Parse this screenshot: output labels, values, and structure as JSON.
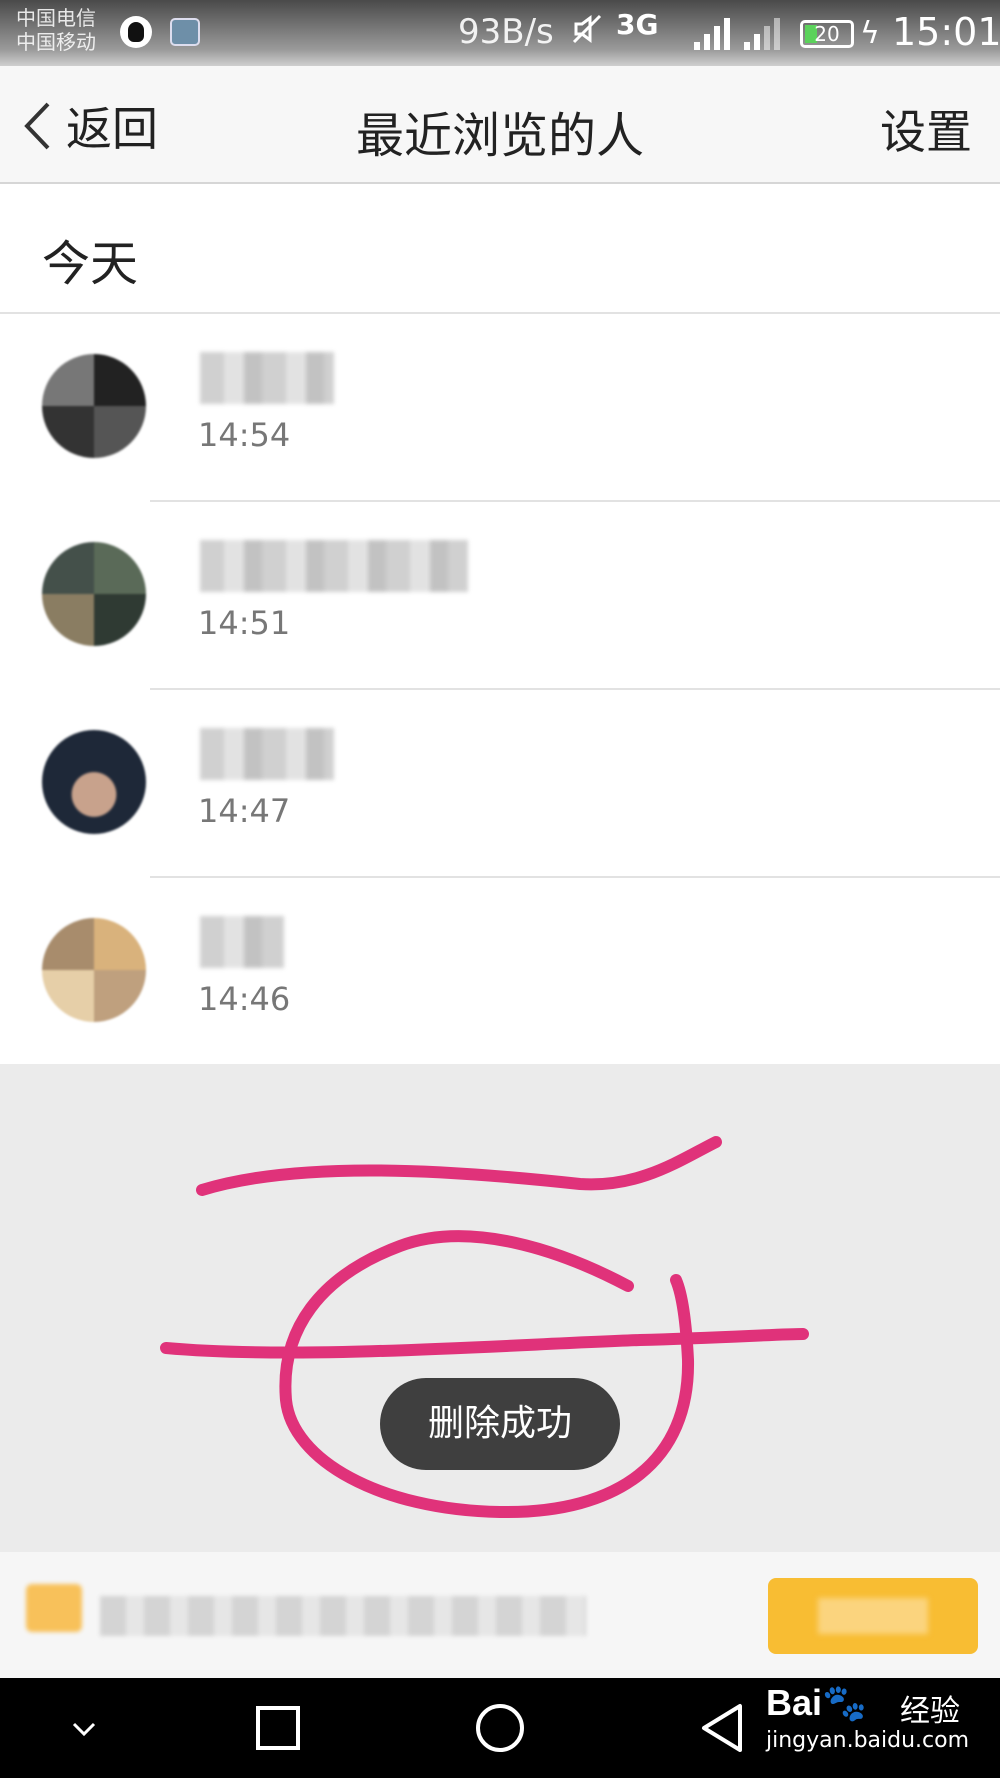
{
  "status_bar": {
    "carrier_1": "中国电信",
    "carrier_2": "中国移动",
    "net_speed": "93B/s",
    "network_type": "3G",
    "battery_level": "20",
    "clock": "15:01",
    "icons": [
      "qq-icon",
      "gallery-icon",
      "mute-icon",
      "signal-icon",
      "battery-icon",
      "charging-icon"
    ]
  },
  "navbar": {
    "back_label": "返回",
    "title": "最近浏览的人",
    "settings_label": "设置"
  },
  "section": {
    "title": "今天"
  },
  "visitors": [
    {
      "time": "14:54"
    },
    {
      "time": "14:51"
    },
    {
      "time": "14:47"
    },
    {
      "time": "14:46"
    }
  ],
  "toast": {
    "text": "删除成功"
  },
  "annotation_color": "#e0327a",
  "banner_color": "#f8bd33",
  "system_nav": {
    "icons": [
      "chevron-down-icon",
      "recents-icon",
      "home-icon",
      "back-icon"
    ]
  },
  "watermark": {
    "brand": "Bai",
    "brand_cn": "经验",
    "url": "jingyan.baidu.com"
  }
}
